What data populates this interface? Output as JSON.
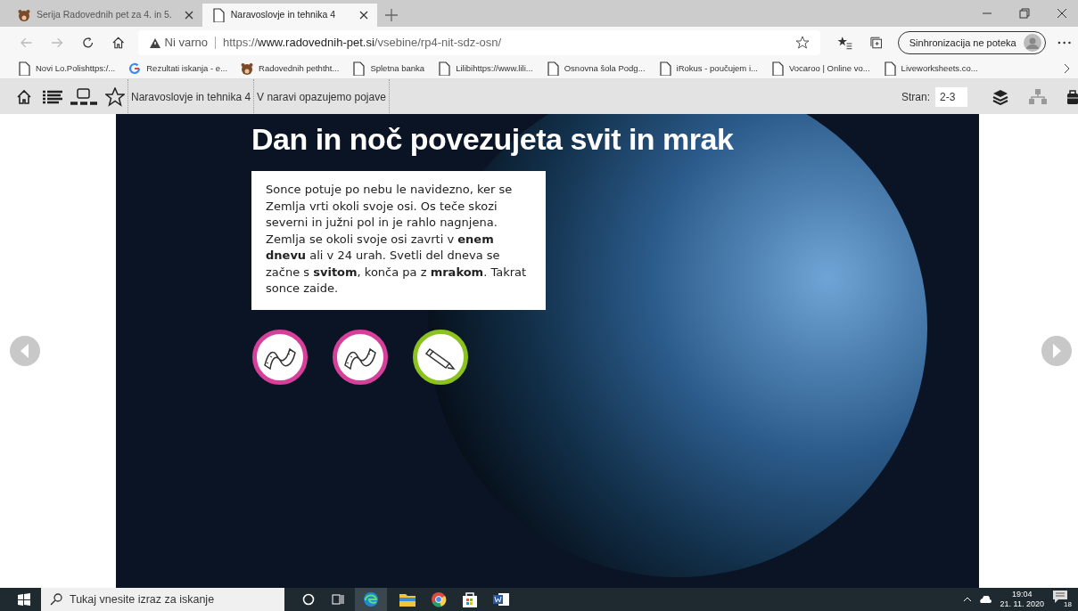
{
  "tabs": [
    {
      "title": "Serija Radovednih pet za 4. in 5.",
      "kind": "bear",
      "selected": false
    },
    {
      "title": "Naravoslovje in tehnika 4",
      "kind": "page",
      "selected": true
    }
  ],
  "address_bar": {
    "security": "Ni varno",
    "url_prefix": "https://",
    "url_domain": "www.radovednih-pet.si",
    "url_path": "/vsebine/rp4-nit-sdz-osn/"
  },
  "sync_button": "Sinhronizacija ne poteka",
  "bookmarks": [
    {
      "label": "Novi Lo.Polishttps:/...",
      "kind": "page"
    },
    {
      "label": "Rezultati iskanja - e...",
      "kind": "google"
    },
    {
      "label": "Radovednih peththt...",
      "kind": "bear"
    },
    {
      "label": "Spletna banka",
      "kind": "page"
    },
    {
      "label": "Lilibihttps://www.lili...",
      "kind": "page"
    },
    {
      "label": "Osnovna šola Podg...",
      "kind": "page"
    },
    {
      "label": "iRokus - poučujem i...",
      "kind": "page"
    },
    {
      "label": "Vocaroo | Online vo...",
      "kind": "page"
    },
    {
      "label": "Liveworksheets.co...",
      "kind": "page"
    }
  ],
  "toolbar": {
    "breadcrumbs": [
      "Naravoslovje in tehnika 4",
      "V naravi opazujemo pojave"
    ],
    "page_label": "Stran:",
    "page_value": "2-3"
  },
  "slide": {
    "title": "Dan in noč povezujeta svit in mrak",
    "text": "Sonce potuje po nebu le navidezno, ker se Zemlja vrti okoli svoje osi. Os teče skozi severni in južni pol in je rahlo nagnjena. Zemlja se okoli svoje osi zavrti v **enem dnevu** ali v 24 urah. Svetli del dneva se začne s **svitom**, konča pa z **mrakom**. Takrat sonce zaide.",
    "buttons": [
      {
        "kind": "film",
        "color": "#d6409a"
      },
      {
        "kind": "film",
        "color": "#d6409a"
      },
      {
        "kind": "pencil",
        "color": "#8cc21d"
      }
    ]
  },
  "taskbar": {
    "search_placeholder": "Tukaj vnesite izraz za iskanje",
    "time": "19:04",
    "date": "21. 11. 2020",
    "notification_count": "18"
  }
}
